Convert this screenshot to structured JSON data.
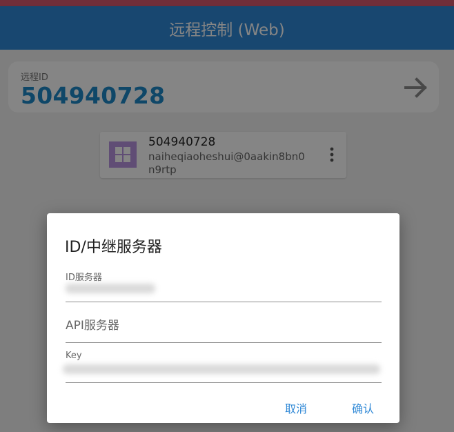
{
  "appbar": {
    "title": "远程控制 (Web)"
  },
  "remote_id": {
    "label": "远程ID",
    "value": "504940728",
    "go_icon": "arrow-right-icon"
  },
  "peer": {
    "id": "504940728",
    "name": "naiheqiaoheshui@0aakin8bn0n9rtp",
    "os_icon": "windows-logo-icon",
    "more_icon": "more-vertical-icon"
  },
  "dialog": {
    "title": "ID/中继服务器",
    "id_server": {
      "label": "ID服务器"
    },
    "api_server": {
      "placeholder": "API服务器"
    },
    "key": {
      "label": "Key"
    },
    "cancel_label": "取消",
    "confirm_label": "确认"
  },
  "colors": {
    "accent": "#2f88d6",
    "id_value": "#1e89c8",
    "top_strip": "#d9586e",
    "os_logo": "#b995e0"
  }
}
